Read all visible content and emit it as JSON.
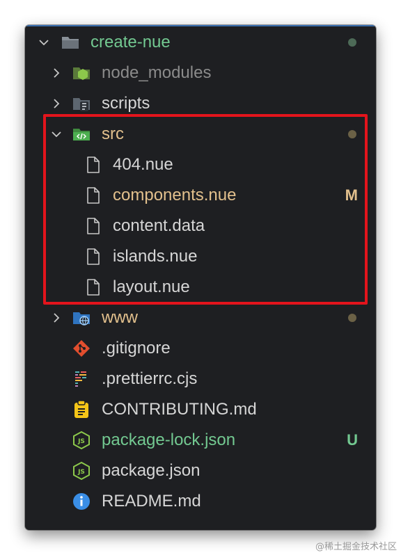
{
  "colors": {
    "background": "#1e1f22",
    "text_default": "#d6d6d6",
    "text_ignored": "#8b8b8b",
    "text_modified": "#e2c08d",
    "text_untracked": "#73c991",
    "dot_root": "#4d6a57",
    "dot_modified": "#6b6146",
    "highlight": "#e3141c"
  },
  "tree": {
    "root": {
      "name": "create-nue",
      "icon": "folder-open-icon"
    },
    "items": [
      {
        "name": "node_modules",
        "icon": "node-folder-icon"
      },
      {
        "name": "scripts",
        "icon": "scripts-folder-icon"
      },
      {
        "name": "src",
        "icon": "src-folder-open-icon"
      },
      {
        "name": "404.nue",
        "icon": "file-icon"
      },
      {
        "name": "components.nue",
        "icon": "file-icon",
        "badge": "M"
      },
      {
        "name": "content.data",
        "icon": "file-icon"
      },
      {
        "name": "islands.nue",
        "icon": "file-icon"
      },
      {
        "name": "layout.nue",
        "icon": "file-icon"
      },
      {
        "name": "www",
        "icon": "www-folder-icon"
      },
      {
        "name": ".gitignore",
        "icon": "git-icon"
      },
      {
        "name": ".prettierrc.cjs",
        "icon": "prettier-icon"
      },
      {
        "name": "CONTRIBUTING.md",
        "icon": "clipboard-icon"
      },
      {
        "name": "package-lock.json",
        "icon": "nodejs-icon",
        "badge": "U"
      },
      {
        "name": "package.json",
        "icon": "nodejs-icon"
      },
      {
        "name": "README.md",
        "icon": "info-icon"
      }
    ]
  },
  "watermark": "@稀土掘金技术社区"
}
